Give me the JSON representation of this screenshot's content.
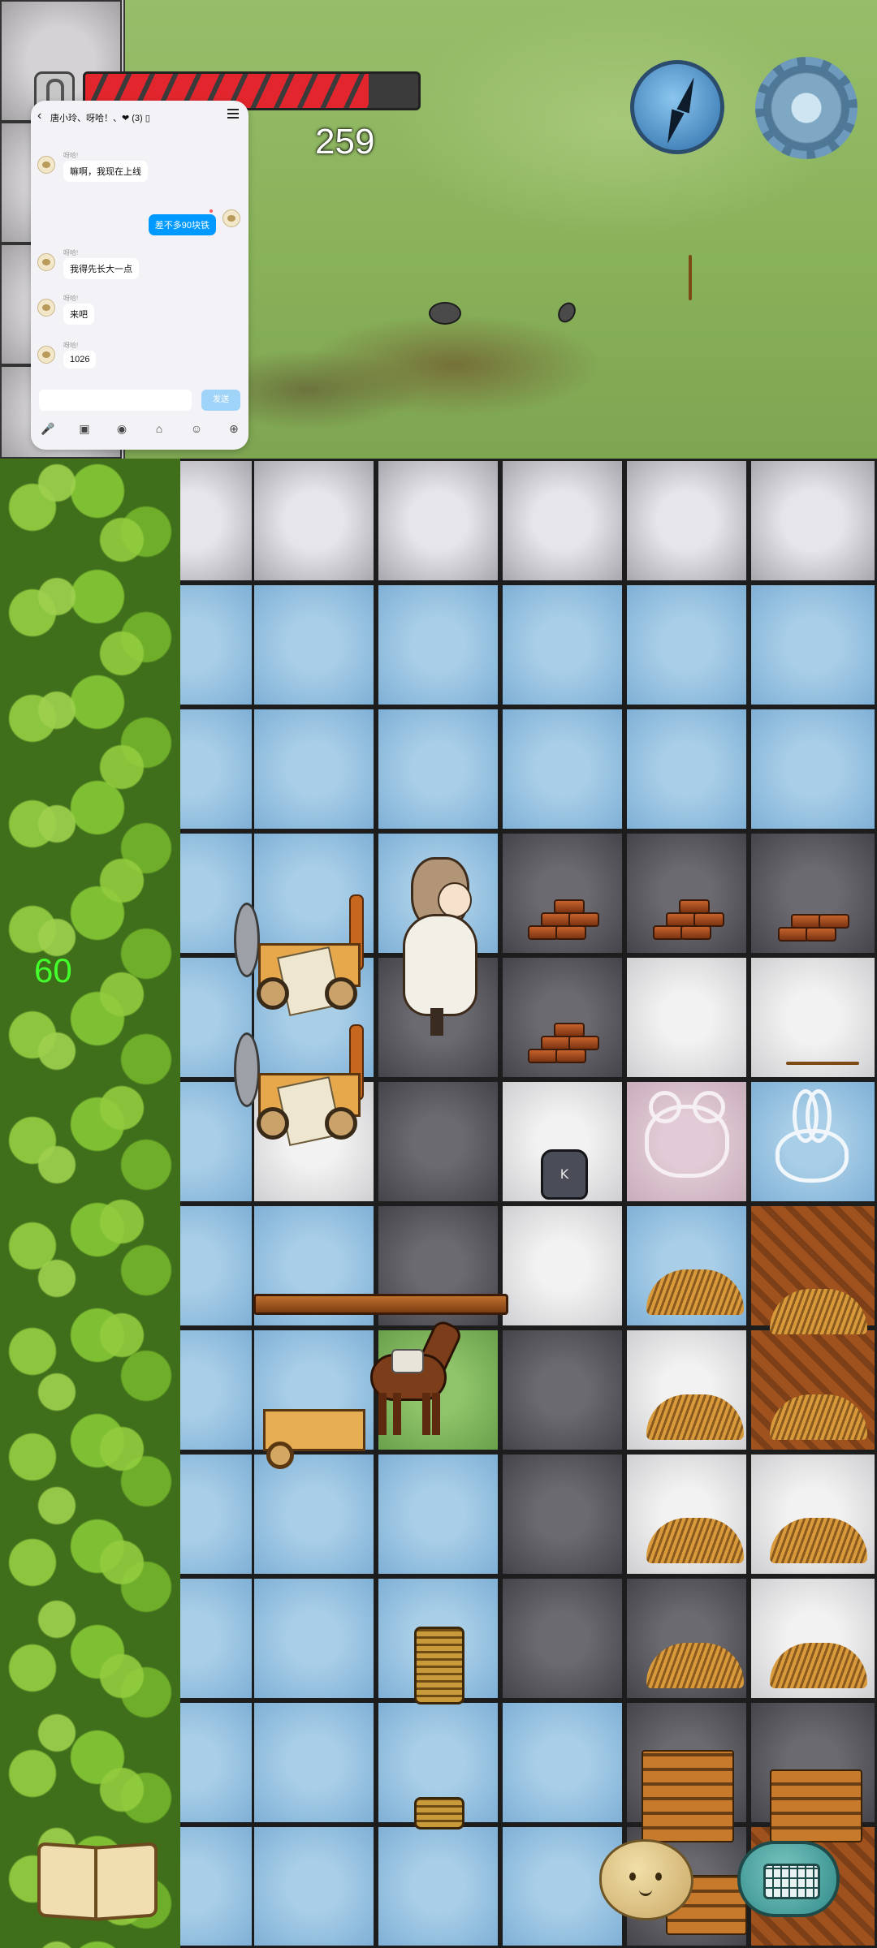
{
  "hud": {
    "health_fraction": 0.85,
    "food_count": "259",
    "fps": "60"
  },
  "icons": {
    "lock": "lock-icon",
    "compass": "compass-icon",
    "settings": "gear-icon",
    "recipe_book": "book-icon",
    "emote": "potato-face-icon",
    "keyboard": "keyboard-icon"
  },
  "chat": {
    "back_icon": "‹",
    "title": "唐小玲、呀哈！、❤ (3) ▯",
    "messages": [
      {
        "sender": "呀哈!",
        "text": "嘛啊，我现在上线",
        "mine": false
      },
      {
        "sender": "",
        "text": "差不多90块铁",
        "mine": true
      },
      {
        "sender": "呀哈!",
        "text": "我得先长大一点",
        "mine": false
      },
      {
        "sender": "呀哈!",
        "text": "来吧",
        "mine": false
      },
      {
        "sender": "呀哈!",
        "text": "1026",
        "mine": false
      }
    ],
    "input_placeholder": "",
    "send_label": "发送",
    "tools": [
      "🎤",
      "▣",
      "◉",
      "⌂",
      "☺",
      "⊕"
    ]
  },
  "colors": {
    "health_red": "#e3262d",
    "fps_green": "#43ff2b",
    "chat_bubble_mine": "#0099ff"
  }
}
